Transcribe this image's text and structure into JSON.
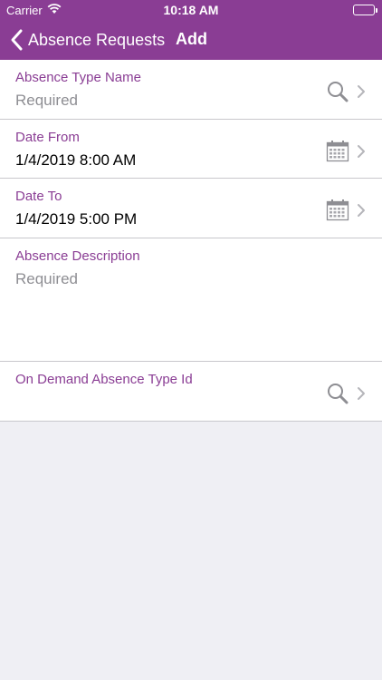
{
  "status_bar": {
    "carrier": "Carrier",
    "time": "10:18 AM"
  },
  "nav": {
    "back_label": "Absence Requests",
    "title": "Add"
  },
  "fields": {
    "absence_type_name": {
      "label": "Absence Type Name",
      "placeholder": "Required"
    },
    "date_from": {
      "label": "Date From",
      "value": "1/4/2019 8:00 AM"
    },
    "date_to": {
      "label": "Date To",
      "value": "1/4/2019 5:00 PM"
    },
    "absence_description": {
      "label": "Absence Description",
      "placeholder": "Required"
    },
    "on_demand_absence_type_id": {
      "label": "On Demand Absence Type Id",
      "value": ""
    }
  },
  "colors": {
    "accent": "#8a3d94",
    "background": "#efeff4",
    "separator": "#c8c7cc",
    "placeholder": "#8e8e93"
  }
}
